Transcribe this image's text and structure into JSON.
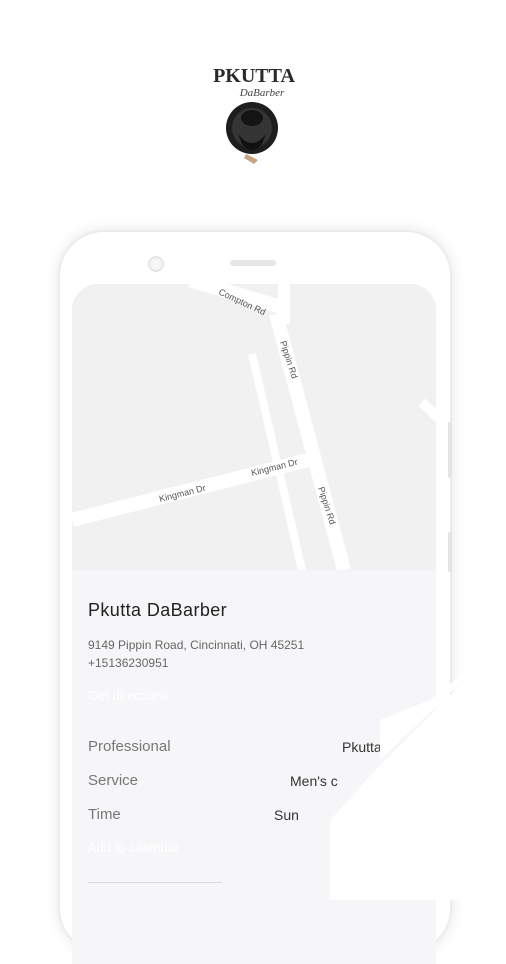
{
  "logo": {
    "alt_text": "PKUTTA DaBarber"
  },
  "map": {
    "roads": [
      "Compton Rd",
      "Pippin Rd",
      "Kingman Dr",
      "Kingman Dr",
      "Pippin Rd"
    ]
  },
  "shop": {
    "name": "Pkutta DaBarber",
    "address": "9149 Pippin Road, Cincinnati, OH 45251",
    "phone": "+15136230951",
    "directions_label": "Get directions"
  },
  "booking": {
    "professional_label": "Professional",
    "professional_value": "Pkutta",
    "service_label": "Service",
    "service_value": "Men's c",
    "time_label": "Time",
    "time_value": "Sun",
    "calendar_label": "Add to calendar"
  }
}
